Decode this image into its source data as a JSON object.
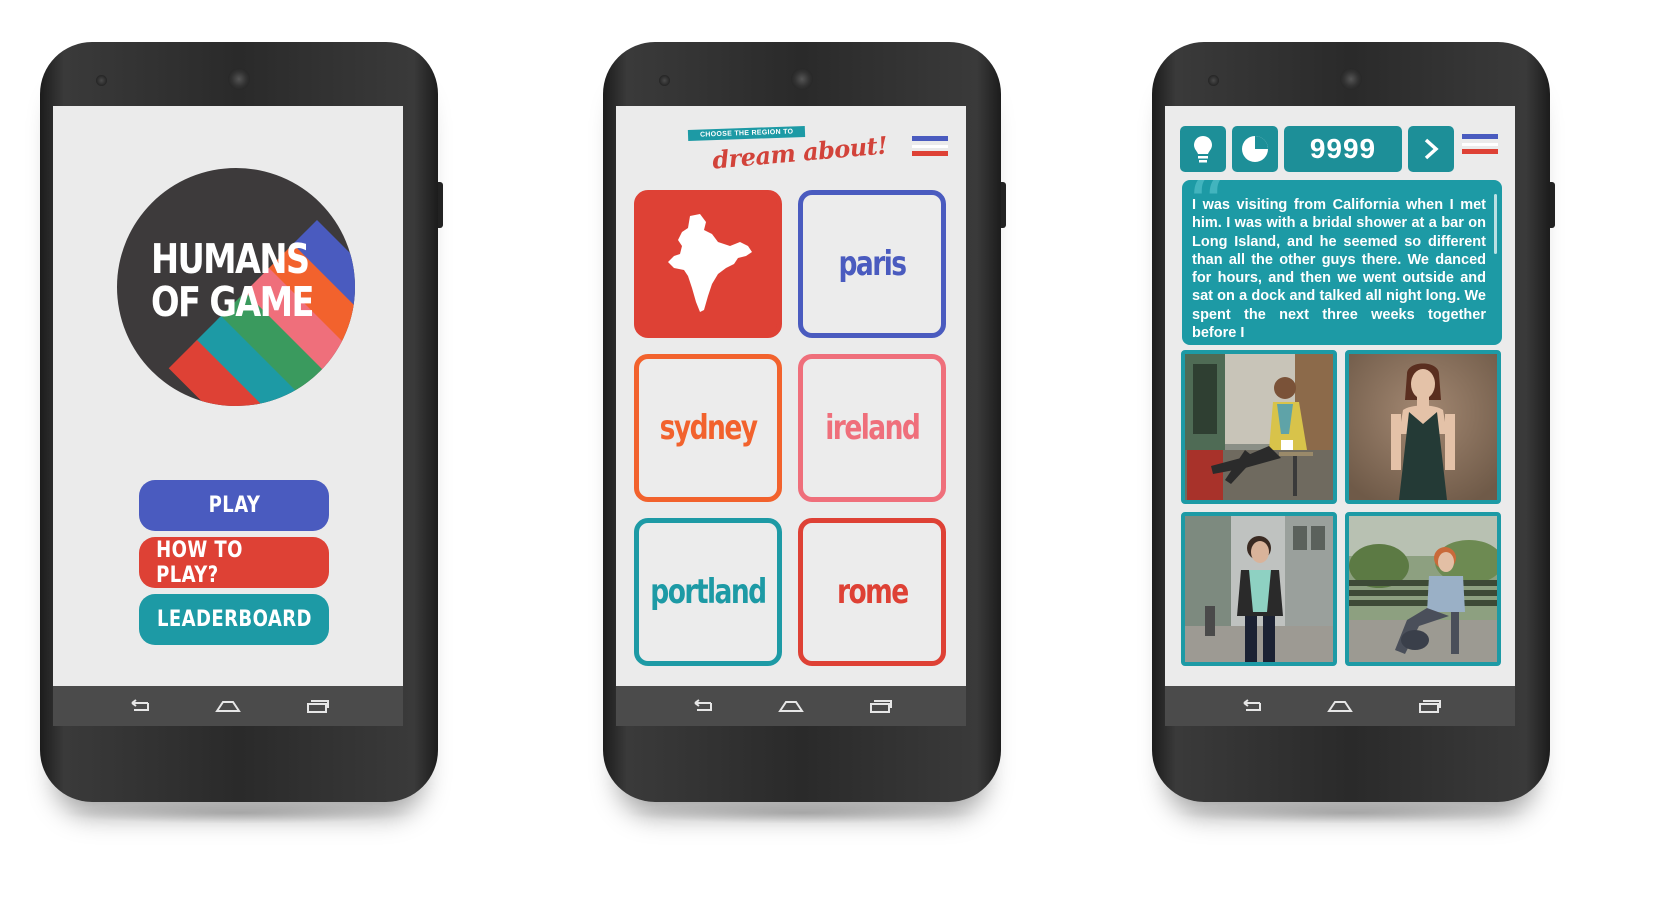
{
  "colors": {
    "blue": "#4a5bbf",
    "red": "#de4135",
    "teal": "#1d9aa5",
    "orange": "#f2622d",
    "pink": "#ef6f7b",
    "dark": "#3d3a3b"
  },
  "screen1": {
    "logo_line1": "HUMANS",
    "logo_line2": "OF GAME",
    "play_label": "PLAY",
    "howto_label": "HOW TO PLAY?",
    "leaderboard_label": "LEADERBOARD"
  },
  "screen2": {
    "header_small": "CHOOSE THE REGION TO",
    "header_script": "dream about!",
    "tiles": [
      "paris",
      "sydney",
      "ireland",
      "portland",
      "rome"
    ],
    "first_tile_icon": "india-map-icon"
  },
  "screen3": {
    "score": "9999",
    "hint_icon": "lightbulb-icon",
    "timer_icon": "pie-timer-icon",
    "next_icon": "chevron-right-icon",
    "story": "I was visiting from California when I met him. I was with a bridal shower at a bar on Long Island, and he seemed so different than all the other guys there. We danced for hours, and then we went outside and sat on a dock and talked all night long. We spent the next three weeks together before I"
  },
  "navbar": {
    "back_icon": "back-icon",
    "home_icon": "home-icon",
    "recents_icon": "recents-icon"
  }
}
